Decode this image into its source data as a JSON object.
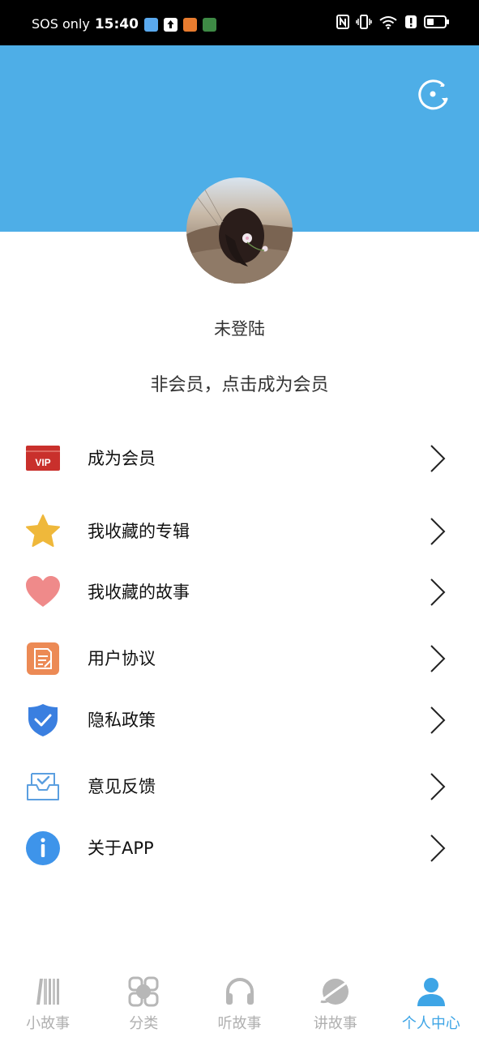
{
  "status_bar": {
    "carrier": "SOS only",
    "time": "15:40"
  },
  "profile": {
    "username": "未登陆",
    "member_status": "非会员，点击成为会员"
  },
  "menu": {
    "items": [
      {
        "label": "成为会员",
        "icon": "vip-icon"
      },
      {
        "label": "我收藏的专辑",
        "icon": "star-icon"
      },
      {
        "label": "我收藏的故事",
        "icon": "heart-icon"
      },
      {
        "label": "用户协议",
        "icon": "document-icon"
      },
      {
        "label": "隐私政策",
        "icon": "shield-check-icon"
      },
      {
        "label": "意见反馈",
        "icon": "inbox-icon"
      },
      {
        "label": "关于APP",
        "icon": "info-icon"
      }
    ]
  },
  "vip_badge": "VIP",
  "tabs": [
    {
      "label": "小故事",
      "icon": "books-icon",
      "active": false
    },
    {
      "label": "分类",
      "icon": "grid-icon",
      "active": false
    },
    {
      "label": "听故事",
      "icon": "headphones-icon",
      "active": false
    },
    {
      "label": "讲故事",
      "icon": "planet-icon",
      "active": false
    },
    {
      "label": "个人中心",
      "icon": "person-icon",
      "active": true
    }
  ],
  "colors": {
    "header": "#4eaee7",
    "accent": "#3ea5e6",
    "inactive_tab": "#b0b0b0",
    "vip": "#c9302c",
    "star": "#efb83b",
    "heart": "#ef8a8a",
    "document": "#ec8a55",
    "shield": "#3a7fe0",
    "info": "#3e94ea"
  }
}
